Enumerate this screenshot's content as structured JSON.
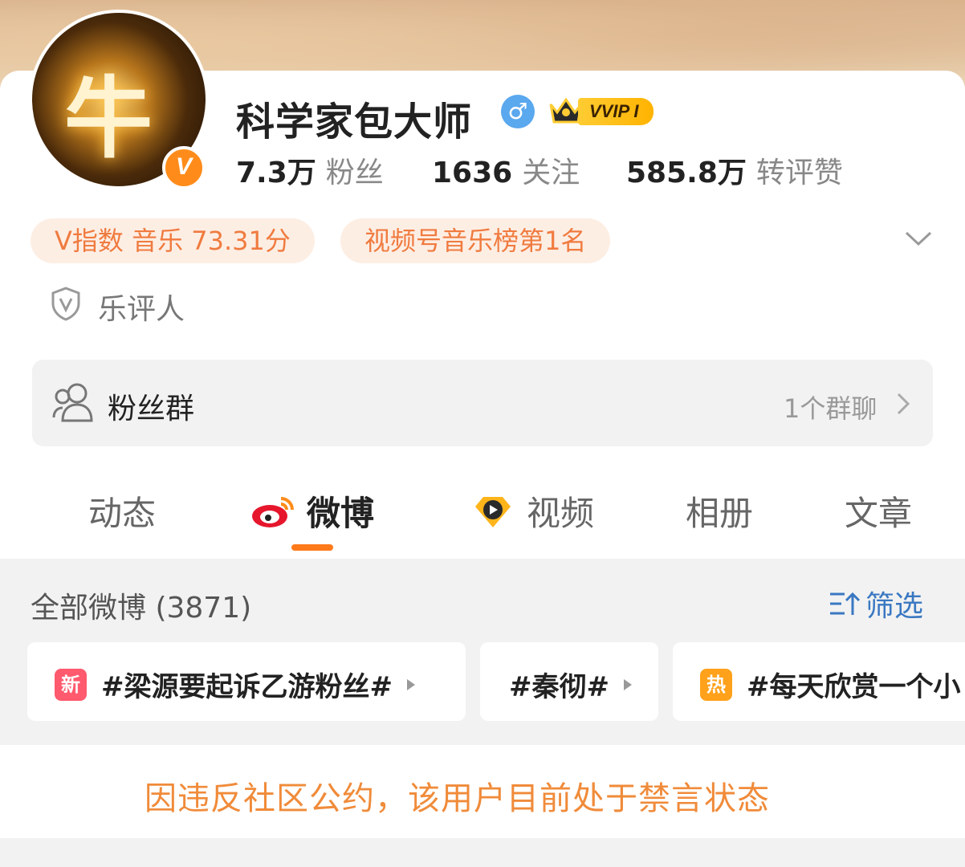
{
  "profile": {
    "name": "科学家包大师",
    "gender_symbol": "♂",
    "vvip_label": "VVIP I",
    "avatar_glyph": "牛",
    "verified_badge": "V",
    "colors": {
      "accent": "#ff7a1a",
      "tag_text": "#f07b3f",
      "tag_bg": "#fdeee4",
      "gender": "#5aa8ee",
      "notice": "#f08b3a",
      "link": "#3a78c2"
    }
  },
  "stats": [
    {
      "value": "7.3万",
      "label": "粉丝"
    },
    {
      "value": "1636",
      "label": "关注"
    },
    {
      "value": "585.8万",
      "label": "转评赞"
    }
  ],
  "tags": [
    "V指数 音乐 73.31分",
    "视频号音乐榜第1名"
  ],
  "certification": {
    "icon": "shield-v-icon",
    "label": "乐评人"
  },
  "fan_group": {
    "label": "粉丝群",
    "right_text": "1个群聊",
    "icon": "people-icon"
  },
  "tabs": [
    {
      "label": "动态",
      "icon": null,
      "active": false
    },
    {
      "label": "微博",
      "icon": "weibo-icon",
      "active": true
    },
    {
      "label": "视频",
      "icon": "video-icon",
      "active": false
    },
    {
      "label": "相册",
      "icon": null,
      "active": false
    },
    {
      "label": "文章",
      "icon": null,
      "active": false
    }
  ],
  "feed": {
    "all_label": "全部微博 (3871)",
    "filter_label": "筛选",
    "topics": [
      {
        "badge": "新",
        "text": "#梁源要起诉乙游粉丝#"
      },
      {
        "badge": null,
        "text": "#秦彻#"
      },
      {
        "badge": "热",
        "text": "#每天欣赏一个小"
      }
    ]
  },
  "notice": "因违反社区公约，该用户目前处于禁言状态"
}
